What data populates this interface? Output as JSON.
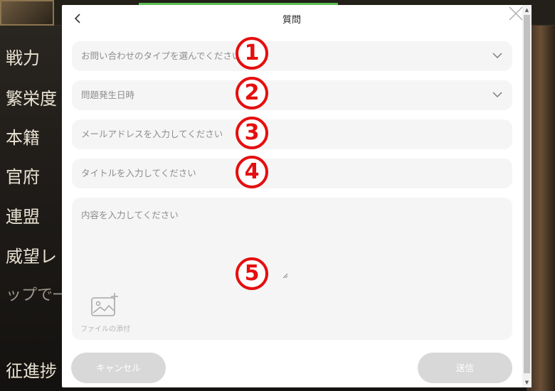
{
  "background": {
    "menu_items": [
      "戦力",
      "繁栄度",
      "本籍",
      "官府",
      "連盟",
      "威望レ",
      "ップで一言",
      "征進捗"
    ]
  },
  "dialog": {
    "title": "質問",
    "fields": {
      "inquiry_type": "お問い合わせのタイプを選んでください",
      "issue_date": "問題発生日時",
      "email_placeholder": "メールアドレスを入力してください",
      "title_placeholder": "タイトルを入力してください",
      "content_placeholder": "内容を入力してください"
    },
    "attach_label": "ファイルの添付",
    "cancel_label": "キャンセル",
    "submit_label": "送信"
  },
  "annotations": [
    "1",
    "2",
    "3",
    "4",
    "5"
  ],
  "colors": {
    "annotation": "#e50f0f",
    "field_bg": "#f5f5f5",
    "button_bg": "#d8d8d8"
  }
}
